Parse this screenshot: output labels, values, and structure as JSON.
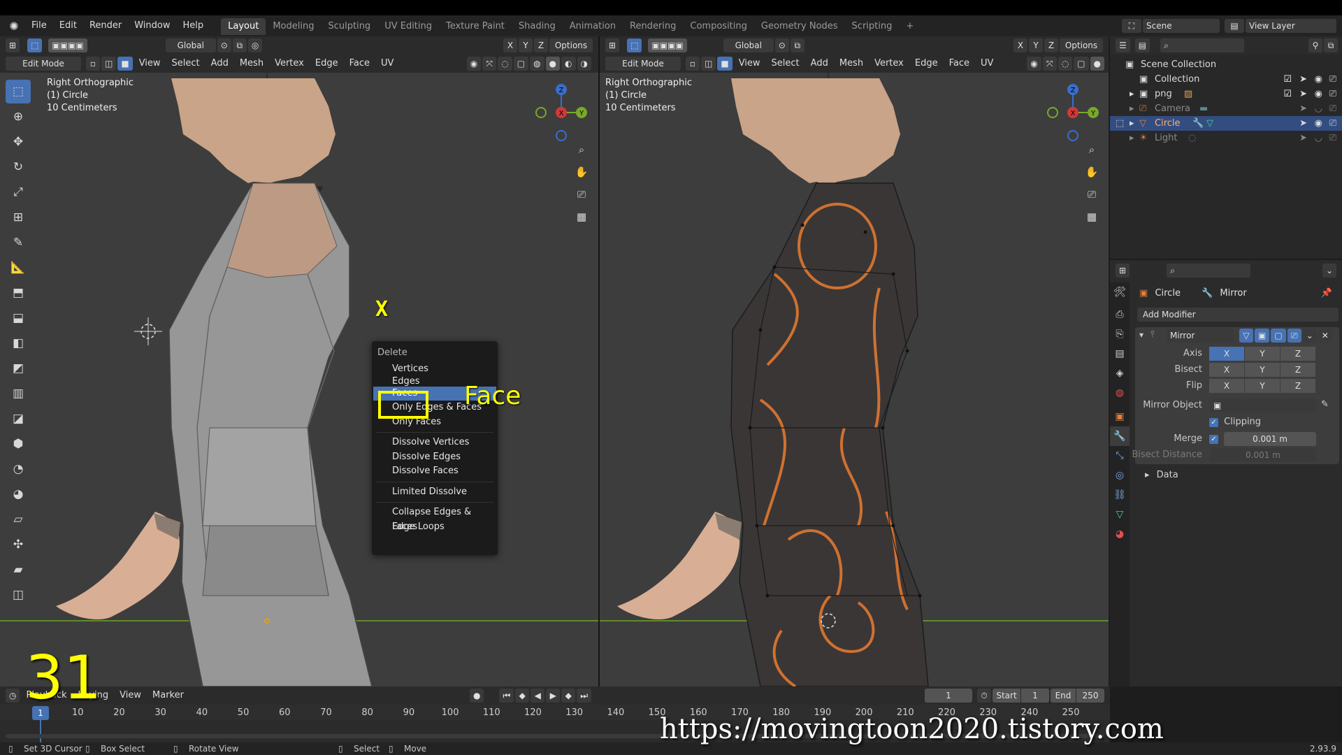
{
  "menubar": {
    "items": [
      "File",
      "Edit",
      "Render",
      "Window",
      "Help"
    ],
    "workspaces": [
      "Layout",
      "Modeling",
      "Sculpting",
      "UV Editing",
      "Texture Paint",
      "Shading",
      "Animation",
      "Rendering",
      "Compositing",
      "Geometry Nodes",
      "Scripting"
    ],
    "active_workspace": "Layout",
    "scene": "Scene",
    "view_layer": "View Layer"
  },
  "viewport_left": {
    "orientation": "Global",
    "options": "Options",
    "mode": "Edit Mode",
    "menus": [
      "View",
      "Select",
      "Add",
      "Mesh",
      "Vertex",
      "Edge",
      "Face",
      "UV"
    ],
    "info": [
      "Right Orthographic",
      "(1) Circle",
      "10 Centimeters"
    ],
    "axes": [
      "X",
      "Y",
      "Z"
    ]
  },
  "viewport_right": {
    "orientation": "Global",
    "options": "Options",
    "mode": "Edit Mode",
    "menus": [
      "View",
      "Select",
      "Add",
      "Mesh",
      "Vertex",
      "Edge",
      "Face",
      "UV"
    ],
    "info": [
      "Right Orthographic",
      "(1) Circle",
      "10 Centimeters"
    ]
  },
  "delete_menu": {
    "title": "Delete",
    "items": [
      "Vertices",
      "Edges",
      "Faces",
      "Only Edges & Faces",
      "Only Faces",
      "Dissolve Vertices",
      "Dissolve Edges",
      "Dissolve Faces",
      "Limited Dissolve",
      "Collapse Edges & Faces",
      "Edge Loops"
    ],
    "selected": "Faces"
  },
  "outliner": {
    "rows": [
      {
        "label": "Scene Collection"
      },
      {
        "label": "Collection"
      },
      {
        "label": "png"
      },
      {
        "label": "Camera"
      },
      {
        "label": "Circle"
      },
      {
        "label": "Light"
      }
    ]
  },
  "properties": {
    "object": "Circle",
    "modifier_tab": "Mirror",
    "add_modifier": "Add Modifier",
    "modifier_name": "Mirror",
    "axis_label": "Axis",
    "bisect_label": "Bisect",
    "flip_label": "Flip",
    "mirror_object_label": "Mirror Object",
    "clipping_label": "Clipping",
    "merge_label": "Merge",
    "merge_value": "0.001 m",
    "bisect_distance_label": "Bisect Distance",
    "bisect_distance_value": "0.001 m",
    "data_label": "Data",
    "axis_on": "X"
  },
  "timeline": {
    "menus": [
      "Playback",
      "Keying",
      "View",
      "Marker"
    ],
    "current_frame": "1",
    "start_label": "Start",
    "start": "1",
    "end_label": "End",
    "end": "250",
    "ticks": [
      "1",
      "10",
      "20",
      "30",
      "40",
      "50",
      "60",
      "70",
      "80",
      "90",
      "100",
      "110",
      "120",
      "130",
      "140",
      "150",
      "160",
      "170",
      "180",
      "190",
      "200",
      "210",
      "220",
      "230",
      "240",
      "250"
    ]
  },
  "statusbar": {
    "items": [
      "Set 3D Cursor",
      "Box Select",
      "Rotate View",
      "Select",
      "Move"
    ],
    "version": "2.93.9"
  },
  "annotations": {
    "key": "X",
    "label": "Face",
    "step": "31",
    "url": "https://movingtoon2020.tistory.com"
  },
  "colors": {
    "accent": "#4772b3",
    "annotation": "#ffff00",
    "mesh_orange": "#e07830"
  }
}
